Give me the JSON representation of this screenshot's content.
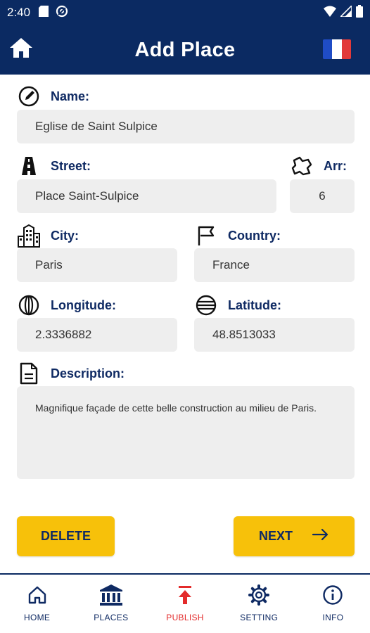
{
  "status_bar": {
    "time": "2:40"
  },
  "header": {
    "title": "Add Place",
    "language_flag": "france-flag"
  },
  "form": {
    "name": {
      "label": "Name:",
      "value": "Eglise de Saint Sulpice",
      "icon": "edit-icon"
    },
    "street": {
      "label": "Street:",
      "value": "Place Saint-Sulpice",
      "icon": "road-icon"
    },
    "arr": {
      "label": "Arr:",
      "value": "6",
      "icon": "district-icon"
    },
    "city": {
      "label": "City:",
      "value": "Paris",
      "icon": "city-icon"
    },
    "country": {
      "label": "Country:",
      "value": "France",
      "icon": "flag-icon"
    },
    "longitude": {
      "label": "Longitude:",
      "value": "2.3336882",
      "icon": "longitude-icon"
    },
    "latitude": {
      "label": "Latitude:",
      "value": "48.8513033",
      "icon": "latitude-icon"
    },
    "description": {
      "label": "Description:",
      "value": "Magnifique façade de cette belle construction au milieu de Paris.",
      "icon": "document-icon"
    }
  },
  "actions": {
    "delete_label": "DELETE",
    "next_label": "NEXT"
  },
  "bottom_nav": {
    "items": [
      {
        "label": "HOME",
        "icon": "home-icon"
      },
      {
        "label": "PLACES",
        "icon": "museum-icon"
      },
      {
        "label": "PUBLISH",
        "icon": "upload-icon",
        "active": true
      },
      {
        "label": "SETTING",
        "icon": "gear-icon"
      },
      {
        "label": "INFO",
        "icon": "info-icon"
      }
    ]
  },
  "colors": {
    "primary": "#0b2a62",
    "accent": "#f7c10a",
    "active": "#e32b2b",
    "field_bg": "#eeeeee"
  }
}
